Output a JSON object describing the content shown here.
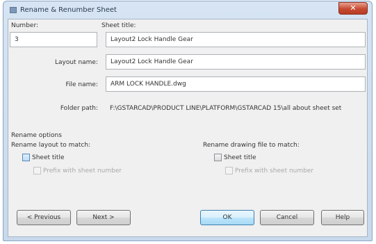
{
  "window": {
    "title": "Rename & Renumber Sheet",
    "close_symbol": "✕"
  },
  "form": {
    "number_label": "Number:",
    "number_value": "3",
    "sheet_title_label": "Sheet title:",
    "sheet_title_value": "Layout2 Lock Handle Gear",
    "layout_name_label": "Layout name:",
    "layout_name_value": "Layout2 Lock Handle Gear",
    "file_name_label": "File name:",
    "file_name_value": "ARM LOCK HANDLE.dwg",
    "folder_path_label": "Folder path:",
    "folder_path_value": "F:\\GSTARCAD\\PRODUCT LINE\\PLATFORM\\GSTARCAD 15\\all about sheet set"
  },
  "rename_options": {
    "heading": "Rename options",
    "layout_heading": "Rename layout to match:",
    "layout_sheet_title": "Sheet title",
    "layout_prefix": "Prefix with sheet number",
    "drawing_heading": "Rename drawing file to match:",
    "drawing_sheet_title": "Sheet title",
    "drawing_prefix": "Prefix with sheet number"
  },
  "buttons": {
    "previous": "< Previous",
    "next": "Next >",
    "ok": "OK",
    "cancel": "Cancel",
    "help": "Help"
  }
}
